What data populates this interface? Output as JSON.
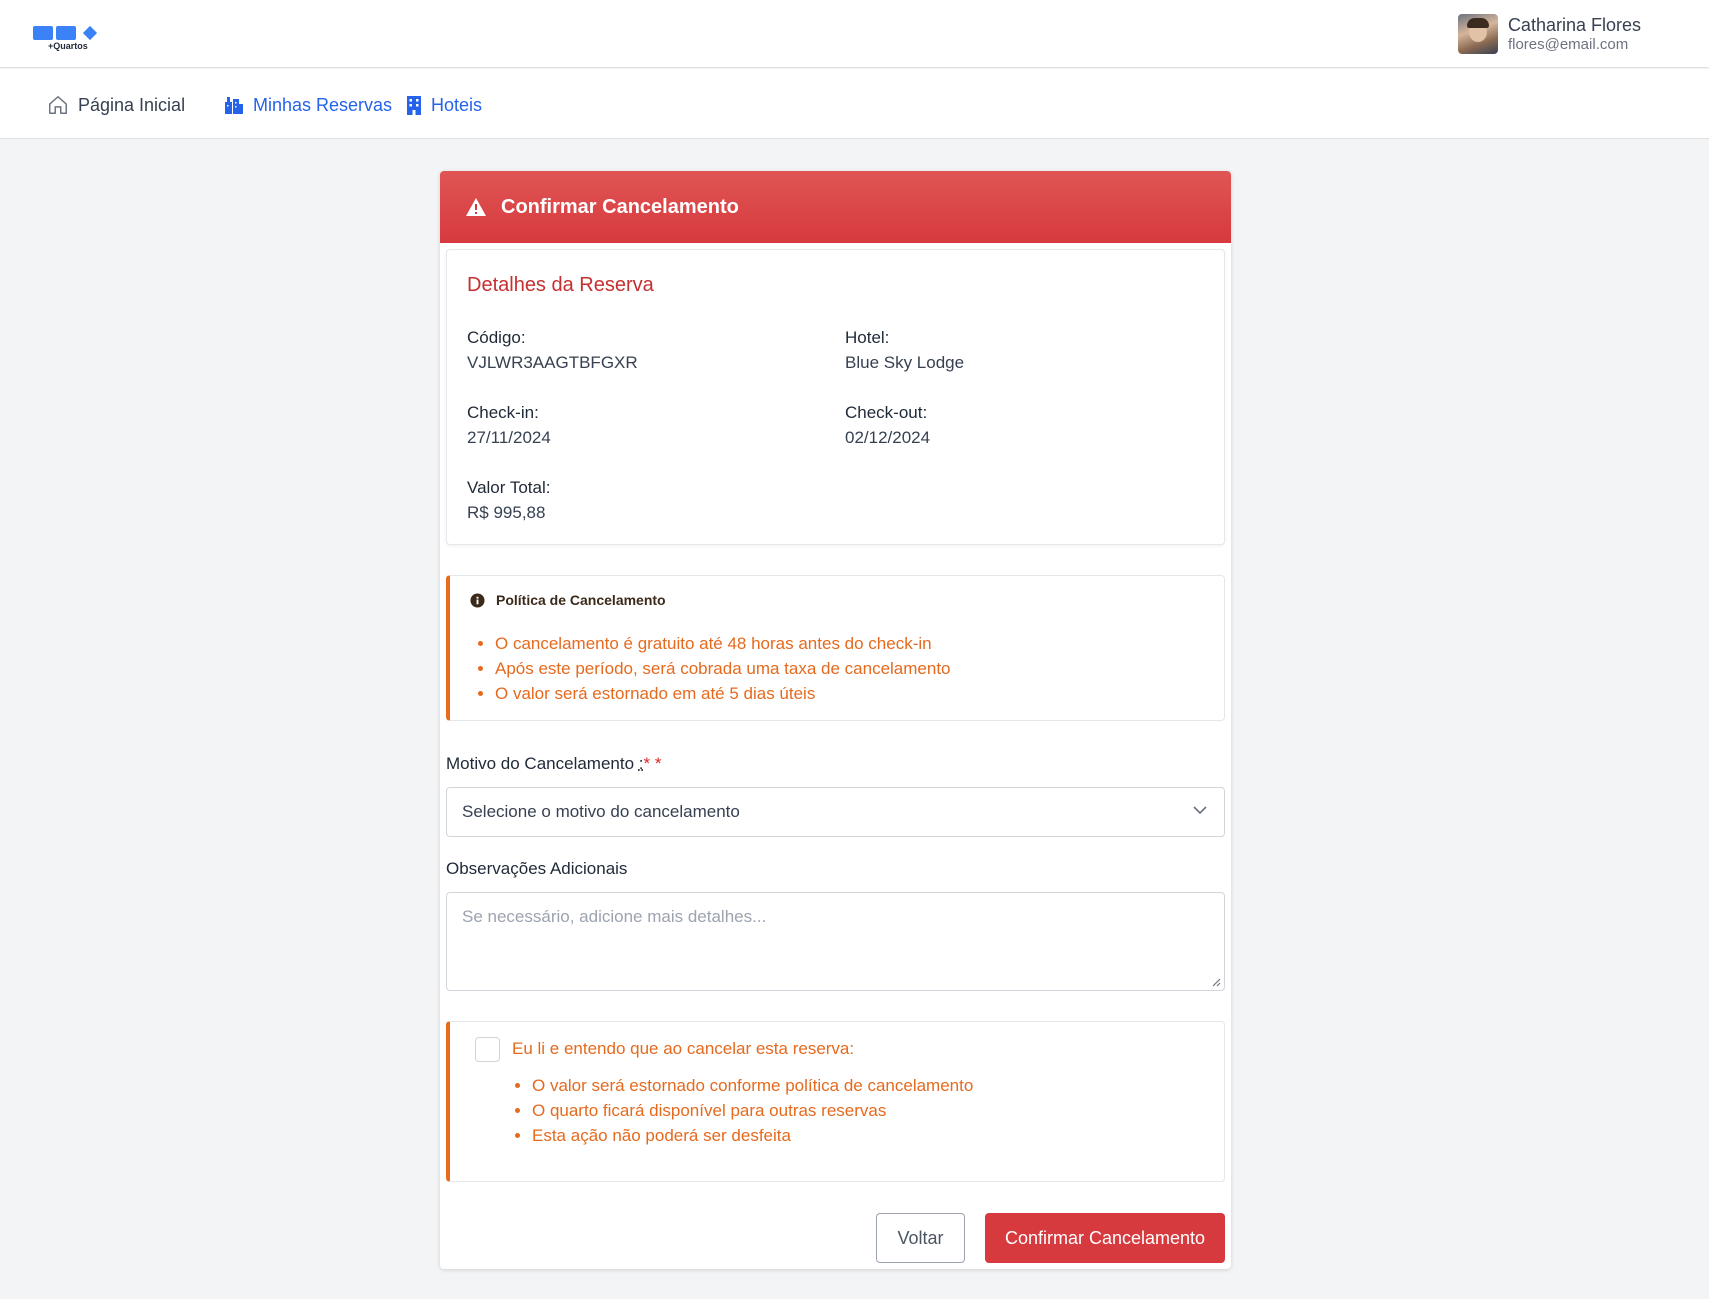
{
  "brand": {
    "logo_text": "+Quartos"
  },
  "user": {
    "name": "Catharina Flores",
    "email": "flores@email.com"
  },
  "nav": {
    "home": "Página Inicial",
    "reservations": "Minhas Reservas",
    "hotels": "Hoteis"
  },
  "modal": {
    "title": "Confirmar Cancelamento",
    "details": {
      "title": "Detalhes da Reserva",
      "code_label": "Código:",
      "code_value": "VJLWR3AAGTBFGXR",
      "hotel_label": "Hotel:",
      "hotel_value": "Blue Sky Lodge",
      "checkin_label": "Check-in:",
      "checkin_value": "27/11/2024",
      "checkout_label": "Check-out:",
      "checkout_value": "02/12/2024",
      "total_label": "Valor Total:",
      "total_value": "R$ 995,88"
    },
    "policy": {
      "title": "Política de Cancelamento",
      "items": [
        "O cancelamento é gratuito até 48 horas antes do check-in",
        "Após este período, será cobrada uma taxa de cancelamento",
        "O valor será estornado em até 5 dias úteis"
      ]
    },
    "reason": {
      "label": "Motivo do Cancelamento",
      "label_suffix": ":",
      "required_mark": "*",
      "placeholder": "Selecione o motivo do cancelamento"
    },
    "notes": {
      "label": "Observações Adicionais",
      "placeholder": "Se necessário, adicione mais detalhes..."
    },
    "acknowledge": {
      "label": "Eu li e entendo que ao cancelar esta reserva:",
      "items": [
        "O valor será estornado conforme política de cancelamento",
        "O quarto ficará disponível para outras reservas",
        "Esta ação não poderá ser desfeita"
      ]
    },
    "buttons": {
      "back": "Voltar",
      "confirm": "Confirmar Cancelamento"
    }
  },
  "colors": {
    "accent_red": "#d63a3e",
    "warning_orange": "#e56a1e",
    "link_blue": "#2563eb"
  }
}
